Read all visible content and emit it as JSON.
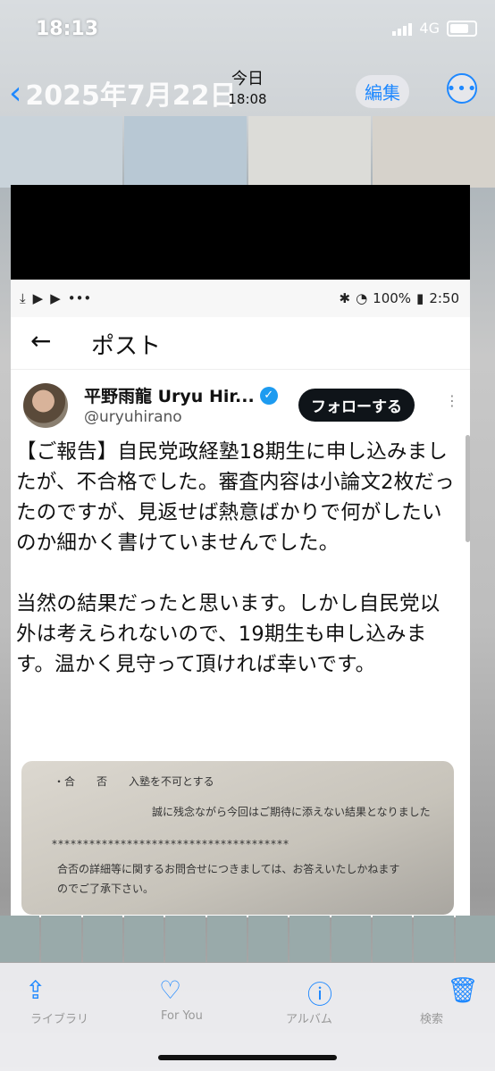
{
  "status": {
    "time": "18:13",
    "network": "4G"
  },
  "nav": {
    "back_label": "2025年7月22日",
    "title": "今日",
    "subtitle": "18:08",
    "edit_label": "編集",
    "more_label": "•••"
  },
  "photo": {
    "android_status": {
      "battery": "100%",
      "time": "2:50"
    },
    "header": {
      "back": "←",
      "title": "ポスト"
    },
    "author": {
      "name": "平野雨龍 Uryu Hir...",
      "handle": "@uryuhirano",
      "follow_label": "フォローする"
    },
    "tweet": {
      "para1": "【ご報告】自民党政経塾18期生に申し込みましたが、不合格でした。審査内容は小論文2枚だったのですが、見返せば熱意ばかりで何がしたいのか細かく書けていませんでした。",
      "para2": "当然の結果だったと思います。しかし自民党以外は考えられないので、19期生も申し込みます。温かく見守って頂ければ幸いです。"
    },
    "document": {
      "line1": "・合　　否　　入塾を不可とする",
      "line2": "誠に残念ながら今回はご期待に添えない結果となりました",
      "line3": "**************************************",
      "line4": "合否の詳細等に関するお問合せにつきましては、お答えいたしかねます",
      "line5": "のでご了承下さい。"
    }
  },
  "tabbar": {
    "tabs": [
      {
        "label": "ライブラリ",
        "icon": "share-icon"
      },
      {
        "label": "For You",
        "icon": "favorite-icon"
      },
      {
        "label": "アルバム",
        "icon": "info-icon"
      },
      {
        "label": "検索",
        "icon": "trash-icon"
      }
    ]
  },
  "colors": {
    "accent": "#1e88ff",
    "verified": "#1d9bf0",
    "follow_bg": "#0f1419"
  }
}
